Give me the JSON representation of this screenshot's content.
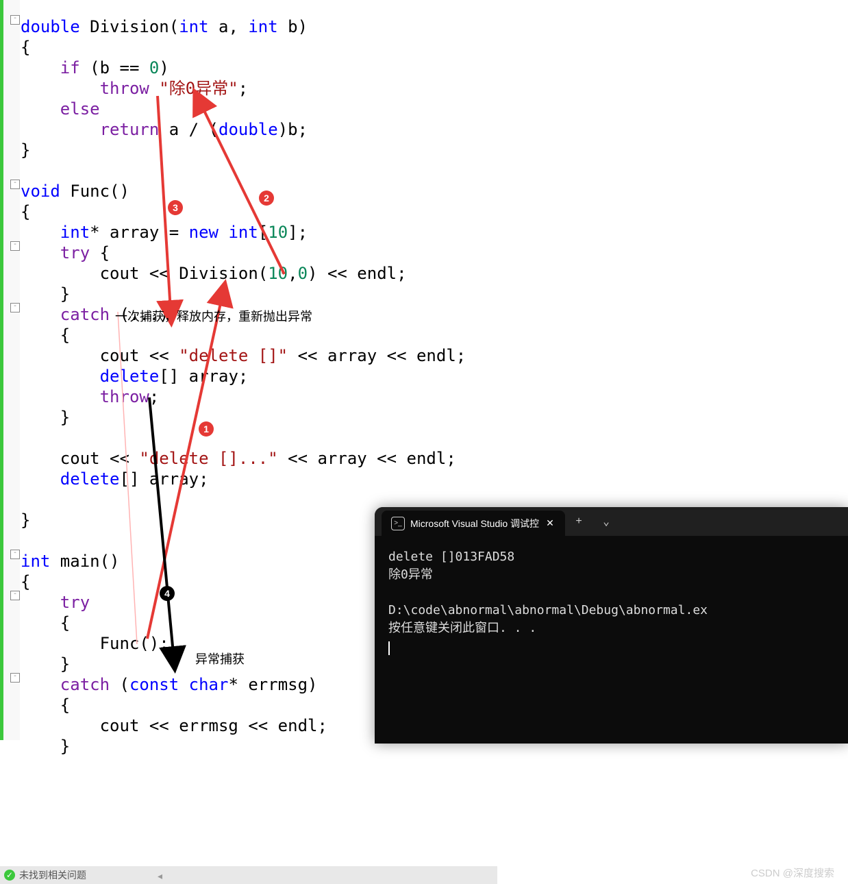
{
  "code": {
    "tokens": [
      [
        {
          "t": "double",
          "c": "kw"
        },
        {
          "t": " Division(",
          "c": "punc"
        },
        {
          "t": "int",
          "c": "kw"
        },
        {
          "t": " a, ",
          "c": "punc"
        },
        {
          "t": "int",
          "c": "kw"
        },
        {
          "t": " b)",
          "c": "punc"
        }
      ],
      [
        {
          "t": "{",
          "c": "punc"
        }
      ],
      [
        {
          "t": "    ",
          "c": ""
        },
        {
          "t": "if",
          "c": "ctrl"
        },
        {
          "t": " (b == ",
          "c": "punc"
        },
        {
          "t": "0",
          "c": "num"
        },
        {
          "t": ")",
          "c": "punc"
        }
      ],
      [
        {
          "t": "        ",
          "c": ""
        },
        {
          "t": "throw",
          "c": "ctrl"
        },
        {
          "t": " ",
          "c": ""
        },
        {
          "t": "\"除0异常\"",
          "c": "str"
        },
        {
          "t": ";",
          "c": "punc"
        }
      ],
      [
        {
          "t": "    ",
          "c": ""
        },
        {
          "t": "else",
          "c": "ctrl"
        }
      ],
      [
        {
          "t": "        ",
          "c": ""
        },
        {
          "t": "return",
          "c": "ctrl"
        },
        {
          "t": " a / (",
          "c": "punc"
        },
        {
          "t": "double",
          "c": "kw"
        },
        {
          "t": ")b;",
          "c": "punc"
        }
      ],
      [
        {
          "t": "}",
          "c": "punc"
        }
      ],
      [
        {
          "t": "",
          "c": ""
        }
      ],
      [
        {
          "t": "void",
          "c": "kw"
        },
        {
          "t": " Func()",
          "c": "punc"
        }
      ],
      [
        {
          "t": "{",
          "c": "punc"
        }
      ],
      [
        {
          "t": "    ",
          "c": ""
        },
        {
          "t": "int",
          "c": "kw"
        },
        {
          "t": "* array = ",
          "c": "punc"
        },
        {
          "t": "new",
          "c": "kw"
        },
        {
          "t": " ",
          "c": ""
        },
        {
          "t": "int",
          "c": "kw"
        },
        {
          "t": "[",
          "c": "punc"
        },
        {
          "t": "10",
          "c": "num"
        },
        {
          "t": "];",
          "c": "punc"
        }
      ],
      [
        {
          "t": "    ",
          "c": ""
        },
        {
          "t": "try",
          "c": "ctrl"
        },
        {
          "t": " {",
          "c": "punc"
        }
      ],
      [
        {
          "t": "        cout << Division(",
          "c": "punc"
        },
        {
          "t": "10",
          "c": "num"
        },
        {
          "t": ",",
          "c": "punc"
        },
        {
          "t": "0",
          "c": "num"
        },
        {
          "t": ") << endl;",
          "c": "punc"
        }
      ],
      [
        {
          "t": "    }",
          "c": "punc"
        }
      ],
      [
        {
          "t": "    ",
          "c": ""
        },
        {
          "t": "catch",
          "c": "ctrl"
        },
        {
          "t": " (...)",
          "c": "punc"
        }
      ],
      [
        {
          "t": "    {",
          "c": "punc"
        }
      ],
      [
        {
          "t": "        cout << ",
          "c": "punc"
        },
        {
          "t": "\"delete []\"",
          "c": "str"
        },
        {
          "t": " << array << endl;",
          "c": "punc"
        }
      ],
      [
        {
          "t": "        ",
          "c": ""
        },
        {
          "t": "delete",
          "c": "kw"
        },
        {
          "t": "[] array;",
          "c": "punc"
        }
      ],
      [
        {
          "t": "        ",
          "c": ""
        },
        {
          "t": "throw",
          "c": "ctrl"
        },
        {
          "t": ";",
          "c": "punc"
        }
      ],
      [
        {
          "t": "    }",
          "c": "punc"
        }
      ],
      [
        {
          "t": "",
          "c": ""
        }
      ],
      [
        {
          "t": "    cout << ",
          "c": "punc"
        },
        {
          "t": "\"delete []...\"",
          "c": "str"
        },
        {
          "t": " << array << endl;",
          "c": "punc"
        }
      ],
      [
        {
          "t": "    ",
          "c": ""
        },
        {
          "t": "delete",
          "c": "kw"
        },
        {
          "t": "[] array;",
          "c": "punc"
        }
      ],
      [
        {
          "t": "",
          "c": ""
        }
      ],
      [
        {
          "t": "}",
          "c": "punc"
        }
      ],
      [
        {
          "t": "",
          "c": ""
        }
      ],
      [
        {
          "t": "int",
          "c": "kw"
        },
        {
          "t": " main()",
          "c": "punc"
        }
      ],
      [
        {
          "t": "{",
          "c": "punc"
        }
      ],
      [
        {
          "t": "    ",
          "c": ""
        },
        {
          "t": "try",
          "c": "ctrl"
        }
      ],
      [
        {
          "t": "    {",
          "c": "punc"
        }
      ],
      [
        {
          "t": "        Func();",
          "c": "punc"
        }
      ],
      [
        {
          "t": "    }",
          "c": "punc"
        }
      ],
      [
        {
          "t": "    ",
          "c": ""
        },
        {
          "t": "catch",
          "c": "ctrl"
        },
        {
          "t": " (",
          "c": "punc"
        },
        {
          "t": "const",
          "c": "kw"
        },
        {
          "t": " ",
          "c": ""
        },
        {
          "t": "char",
          "c": "kw"
        },
        {
          "t": "* errmsg)",
          "c": "punc"
        }
      ],
      [
        {
          "t": "    {",
          "c": "punc"
        }
      ],
      [
        {
          "t": "        cout << errmsg << endl;",
          "c": "punc"
        }
      ],
      [
        {
          "t": "    }",
          "c": "punc"
        }
      ]
    ]
  },
  "annotations": {
    "catch_note": "一次捕获，释放内存，重新抛出异常",
    "main_note": "异常捕获"
  },
  "badges": {
    "b1": "1",
    "b2": "2",
    "b3": "3",
    "b4": "4"
  },
  "console": {
    "tab_title": "Microsoft Visual Studio 调试控",
    "line1": "delete []013FAD58",
    "line2": "除0异常",
    "line3": "",
    "line4": "D:\\code\\abnormal\\abnormal\\Debug\\abnormal.ex",
    "line5": "按任意键关闭此窗口. . ."
  },
  "statusbar": {
    "text": "未找到相关问题"
  },
  "watermark": "CSDN @深度搜索"
}
